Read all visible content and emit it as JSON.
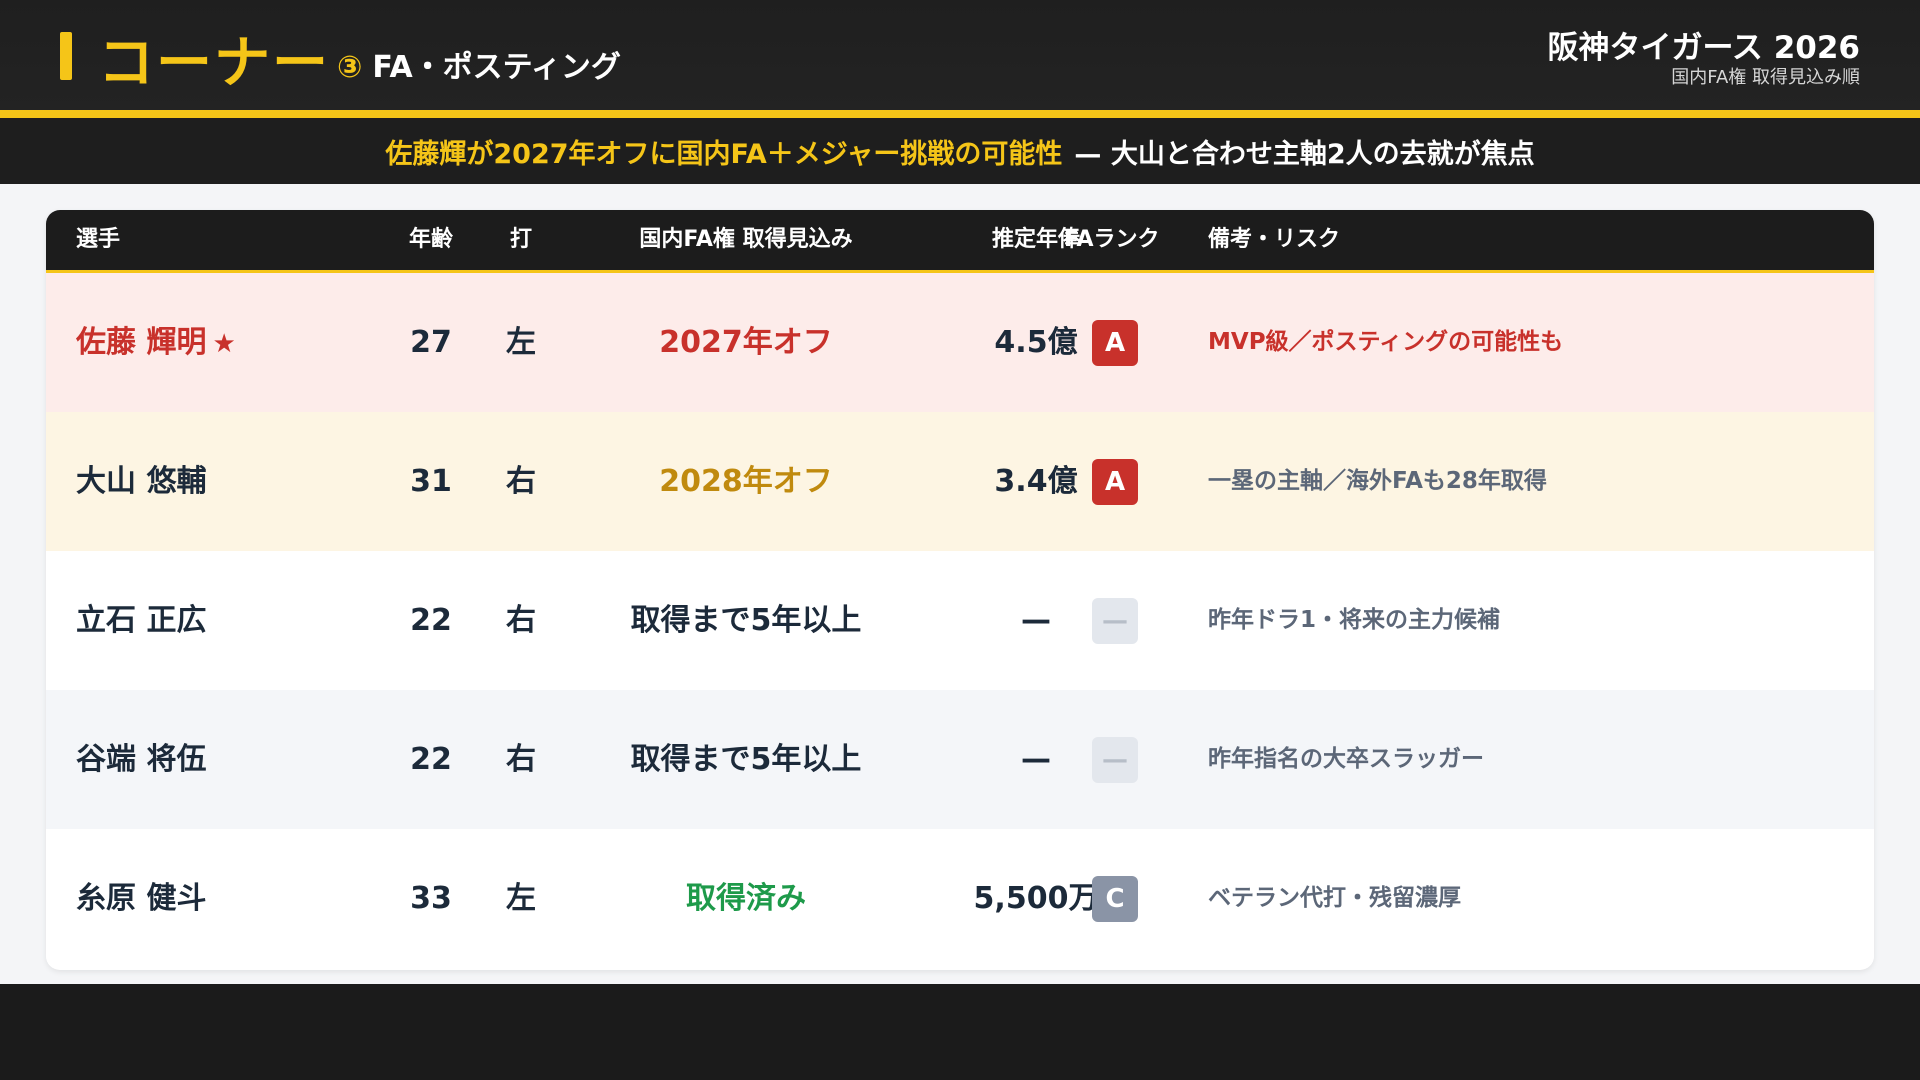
{
  "header": {
    "corner_title": "コーナー",
    "corner_number": "③",
    "corner_subtitle": "FA・ポスティング",
    "team_title": "阪神タイガース 2026",
    "team_subtitle": "国内FA権 取得見込み順"
  },
  "banner": {
    "highlight": "佐藤輝が2027年オフに国内FA＋メジャー挑戦の可能性",
    "rest": "— 大山と合わせ主軸2人の去就が焦点"
  },
  "table": {
    "columns": {
      "name": "選手",
      "age": "年齢",
      "bat": "打",
      "fa": "国内FA権 取得見込み",
      "salary": "推定年俸",
      "rank": "FAランク",
      "note": "備考・リスク"
    },
    "rows": [
      {
        "name": "佐藤 輝明",
        "star": "★",
        "age": "27",
        "bat": "左",
        "fa": "2027年オフ",
        "salary": "4.5億",
        "rank": "A",
        "note": "MVP級／ポスティングの可能性も",
        "bg": "#fdecea",
        "name_color": "#c8312b",
        "fa_color": "#c8312b",
        "note_color": "#c8312b",
        "rank_bg": "#c8312b",
        "rank_fg": "#ffffff"
      },
      {
        "name": "大山 悠輔",
        "star": "",
        "age": "31",
        "bat": "右",
        "fa": "2028年オフ",
        "salary": "3.4億",
        "rank": "A",
        "note": "一塁の主軸／海外FAも28年取得",
        "bg": "#fdf5e3",
        "name_color": "#1c2a3a",
        "fa_color": "#c08a0e",
        "note_color": "#5c6778",
        "rank_bg": "#c8312b",
        "rank_fg": "#ffffff"
      },
      {
        "name": "立石 正広",
        "star": "",
        "age": "22",
        "bat": "右",
        "fa": "取得まで5年以上",
        "salary": "—",
        "rank": "—",
        "note": "昨年ドラ1・将来の主力候補",
        "bg": "#ffffff",
        "name_color": "#1c2a3a",
        "fa_color": "#1c2a3a",
        "note_color": "#5c6778",
        "rank_bg": "#e3e7ed",
        "rank_fg": "#b7bec8"
      },
      {
        "name": "谷端 将伍",
        "star": "",
        "age": "22",
        "bat": "右",
        "fa": "取得まで5年以上",
        "salary": "—",
        "rank": "—",
        "note": "昨年指名の大卒スラッガー",
        "bg": "#f4f6f9",
        "name_color": "#1c2a3a",
        "fa_color": "#1c2a3a",
        "note_color": "#5c6778",
        "rank_bg": "#e3e7ed",
        "rank_fg": "#b7bec8"
      },
      {
        "name": "糸原 健斗",
        "star": "",
        "age": "33",
        "bat": "左",
        "fa": "取得済み",
        "salary": "5,500万",
        "rank": "C",
        "note": "ベテラン代打・残留濃厚",
        "bg": "#ffffff",
        "name_color": "#1c2a3a",
        "fa_color": "#1e9a4a",
        "note_color": "#5c6778",
        "rank_bg": "#8a94a6",
        "rank_fg": "#ffffff"
      }
    ]
  }
}
